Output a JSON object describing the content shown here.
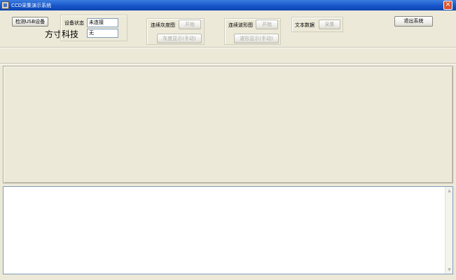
{
  "window": {
    "title": "CCD采集演示系统",
    "close_glyph": "×",
    "icon": "app-icon"
  },
  "toolbar": {
    "detect_usb_label": "检测USB设备",
    "brand_text": "方寸科技",
    "device_status": {
      "label": "设备状态",
      "status_value": "未连接",
      "second_value": "无"
    },
    "gray_image": {
      "label": "连续灰度图",
      "start_label": "开始",
      "manual_label": "灰度显示(手动)"
    },
    "waveform": {
      "label": "连续波形图",
      "start_label": "开始",
      "manual_label": "波形显示(手动)"
    },
    "text_data": {
      "label": "文本数据",
      "collect_label": "采集"
    },
    "exit_label": "退出系统"
  },
  "scrollbar": {
    "up_glyph": "▲",
    "down_glyph": "▼"
  }
}
